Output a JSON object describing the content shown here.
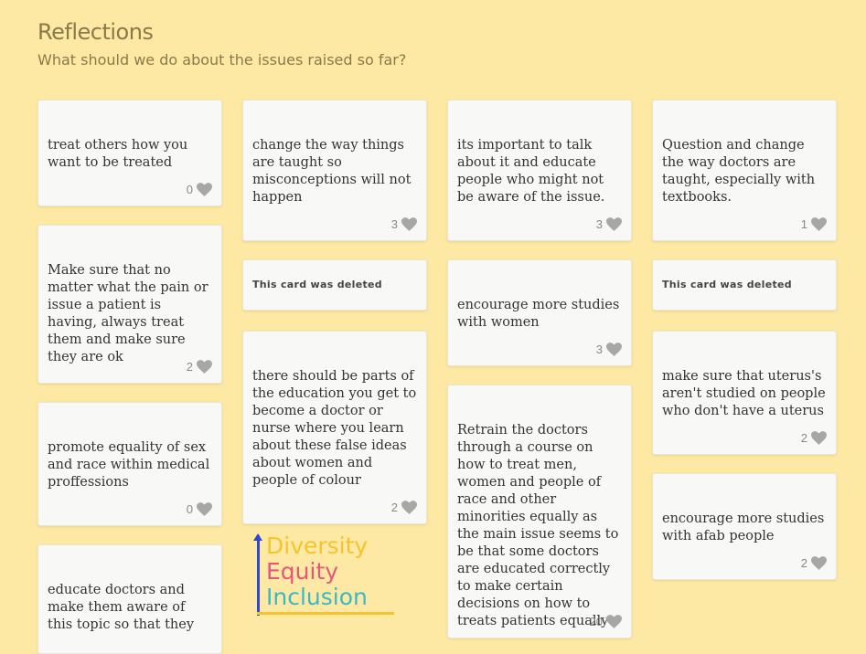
{
  "header": {
    "title": "Reflections",
    "subtitle": "What should we do about the issues raised so far?"
  },
  "cards": [
    {
      "text": "treat others how you want to be treated",
      "likes": "0"
    },
    {
      "text": "Make sure that no matter what the pain or issue a patient is having, always treat them and make sure they are ok",
      "likes": "2"
    },
    {
      "text": "promote equality of sex and race within medical proffessions",
      "likes": "0"
    },
    {
      "text": "educate doctors and make them aware of this topic so that they"
    },
    {
      "text": "change the way things are taught so misconceptions will not happen",
      "likes": "3"
    },
    {
      "text": "there should be parts of the education you get to become a doctor or nurse where you learn about these false ideas about women and people of colour",
      "likes": "2"
    },
    {
      "text": "its important to talk about it and educate people who might not be aware of the issue.",
      "likes": "3"
    },
    {
      "text": "encourage more studies with women",
      "likes": "3"
    },
    {
      "text": "Retrain the doctors through a course on how to treat men, women and people of race and other minorities equally as the main issue seems to be that some doctors are educated correctly to make certain decisions on how to treats patients equally",
      "likes": "20"
    },
    {
      "text": "Question and change the way doctors are taught, especially with textbooks.",
      "likes": "1"
    },
    {
      "text": "make sure that uterus's aren't studied on people who don't have a uterus",
      "likes": "2"
    },
    {
      "text": "encourage more studies with afab people",
      "likes": "2"
    }
  ],
  "deleted_cards": [
    {
      "label": "This card was deleted"
    },
    {
      "label": "This card was deleted"
    }
  ],
  "logo": {
    "line1": "Diversity",
    "line2": "Equity",
    "line3": "Inclusion",
    "colors": {
      "diversity": "#f4c430",
      "equity": "#e8557a",
      "inclusion": "#3bb8c4",
      "axis": "#2f47c8"
    }
  },
  "icons": {
    "like": "heart-icon"
  },
  "colors": {
    "background": "#fde9a3",
    "title": "#8a7a4a",
    "card": "#f8f8f7",
    "heart": "#a7a7a7"
  }
}
